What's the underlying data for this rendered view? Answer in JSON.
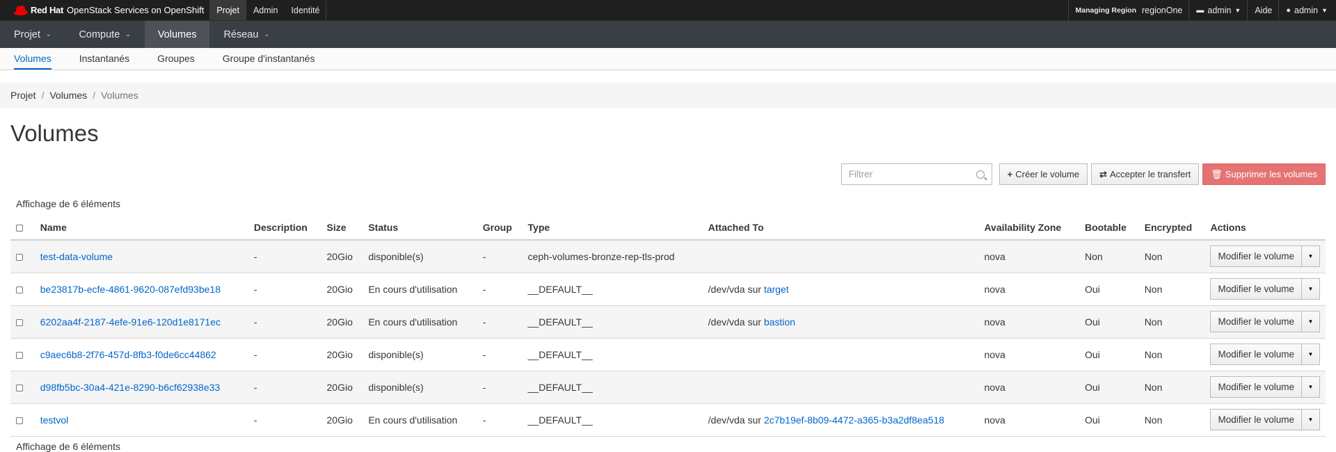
{
  "masthead": {
    "brand_bold": "Red Hat",
    "brand_name": "OpenStack Services on OpenShift",
    "nav": [
      "Projet",
      "Admin",
      "Identité"
    ],
    "region_label": "Managing Region",
    "region_value": "regionOne",
    "project_label": "admin",
    "help_label": "Aide",
    "user_label": "admin",
    "colors": {
      "background": "#1f1f1f",
      "brand_red": "#ee0000"
    }
  },
  "primary_nav": [
    "Projet",
    "Compute",
    "Volumes",
    "Réseau"
  ],
  "secondary_nav": [
    "Volumes",
    "Instantanés",
    "Groupes",
    "Groupe d'instantanés"
  ],
  "breadcrumb": {
    "items": [
      "Projet",
      "Volumes"
    ],
    "current": "Volumes"
  },
  "page_title": "Volumes",
  "toolbar": {
    "filter_placeholder": "Filtrer",
    "create_label": "Créer le volume",
    "transfer_label": "Accepter le transfert",
    "delete_label": "Supprimer les volumes"
  },
  "count_label": "Affichage de 6 éléments",
  "table": {
    "headers": [
      "Name",
      "Description",
      "Size",
      "Status",
      "Group",
      "Type",
      "Attached To",
      "Availability Zone",
      "Bootable",
      "Encrypted",
      "Actions"
    ],
    "attach_on": "sur",
    "action_label": "Modifier le volume",
    "rows": [
      {
        "name": "test-data-volume",
        "description": "-",
        "size": "20Gio",
        "status": "disponible(s)",
        "group": "-",
        "type": "ceph-volumes-bronze-rep-tls-prod",
        "attached_dev": "",
        "attached_host": "",
        "zone": "nova",
        "bootable": "Non",
        "encrypted": "Non"
      },
      {
        "name": "be23817b-ecfe-4861-9620-087efd93be18",
        "description": "-",
        "size": "20Gio",
        "status": "En cours d'utilisation",
        "group": "-",
        "type": "__DEFAULT__",
        "attached_dev": "/dev/vda",
        "attached_host": "target",
        "zone": "nova",
        "bootable": "Oui",
        "encrypted": "Non"
      },
      {
        "name": "6202aa4f-2187-4efe-91e6-120d1e8171ec",
        "description": "-",
        "size": "20Gio",
        "status": "En cours d'utilisation",
        "group": "-",
        "type": "__DEFAULT__",
        "attached_dev": "/dev/vda",
        "attached_host": "bastion",
        "zone": "nova",
        "bootable": "Oui",
        "encrypted": "Non"
      },
      {
        "name": "c9aec6b8-2f76-457d-8fb3-f0de6cc44862",
        "description": "-",
        "size": "20Gio",
        "status": "disponible(s)",
        "group": "-",
        "type": "__DEFAULT__",
        "attached_dev": "",
        "attached_host": "",
        "zone": "nova",
        "bootable": "Oui",
        "encrypted": "Non"
      },
      {
        "name": "d98fb5bc-30a4-421e-8290-b6cf62938e33",
        "description": "-",
        "size": "20Gio",
        "status": "disponible(s)",
        "group": "-",
        "type": "__DEFAULT__",
        "attached_dev": "",
        "attached_host": "",
        "zone": "nova",
        "bootable": "Oui",
        "encrypted": "Non"
      },
      {
        "name": "testvol",
        "description": "-",
        "size": "20Gio",
        "status": "En cours d'utilisation",
        "group": "-",
        "type": "__DEFAULT__",
        "attached_dev": "/dev/vda",
        "attached_host": "2c7b19ef-8b09-4472-a365-b3a2df8ea518",
        "zone": "nova",
        "bootable": "Oui",
        "encrypted": "Non"
      }
    ]
  },
  "footer_count": "Affichage de 6 éléments"
}
